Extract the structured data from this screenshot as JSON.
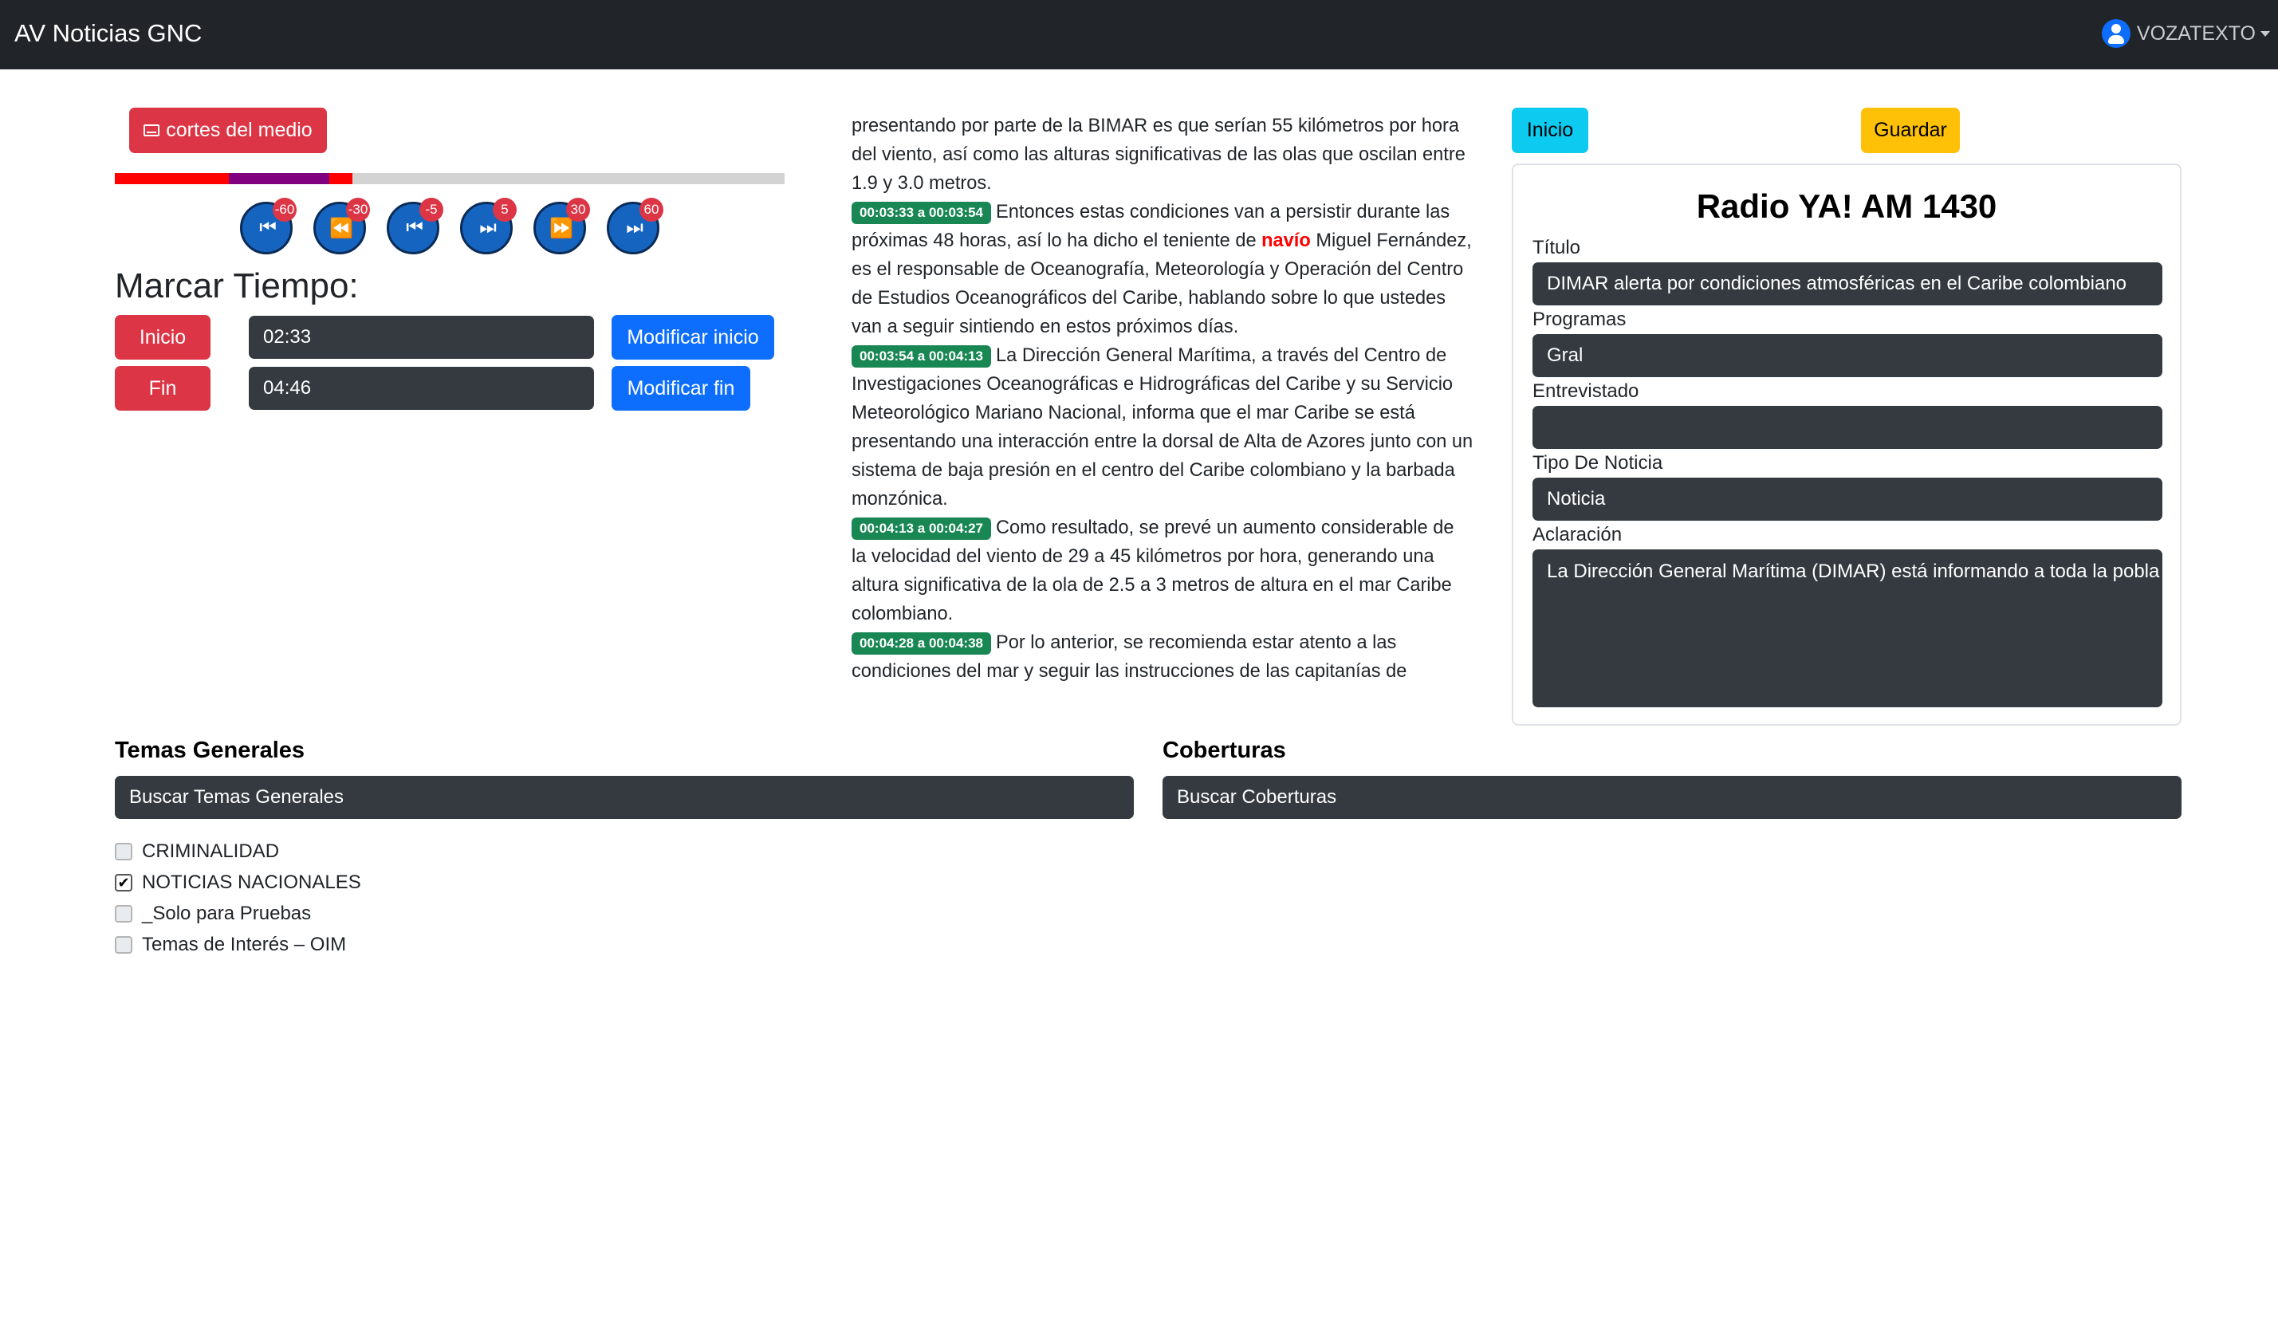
{
  "navbar": {
    "brand": "AV Noticias GNC",
    "user": "VOZATEXTO"
  },
  "player": {
    "cortes_label": "cortes del medio",
    "progress_segments": [
      {
        "from": 0.0,
        "to": 0.17,
        "color": "#ff0000"
      },
      {
        "from": 0.17,
        "to": 0.32,
        "color": "#800080"
      },
      {
        "from": 0.32,
        "to": 0.355,
        "color": "#ff0000"
      }
    ],
    "controls": [
      {
        "glyph": "⏮",
        "badge": "-60"
      },
      {
        "glyph": "⏪",
        "badge": "-30"
      },
      {
        "glyph": "⏮",
        "badge": "-5"
      },
      {
        "glyph": "⏭",
        "badge": "5"
      },
      {
        "glyph": "⏩",
        "badge": "30"
      },
      {
        "glyph": "⏭",
        "badge": "60"
      }
    ]
  },
  "marcar": {
    "title": "Marcar Tiempo:",
    "inicio_label": "Inicio",
    "inicio_value": "02:33",
    "modificar_inicio_label": "Modificar inicio",
    "fin_label": "Fin",
    "fin_value": "04:46",
    "modificar_fin_label": "Modificar fin"
  },
  "transcript": {
    "intro": "presentando por parte de la BIMAR es que serían 55 kilómetros por hora del viento, así como las alturas significativas de las olas que oscilan entre 1.9 y 3.0 metros.",
    "seg1_ts": "00:03:33 a 00:03:54",
    "seg1_a": "Entonces estas condiciones van a persistir durante las próximas 48 horas, así lo ha dicho el teniente de",
    "seg1_hl": "navío",
    "seg1_b": "Miguel Fernández, es el responsable de Oceanografía, Meteorología y Operación del Centro de Estudios Oceanográficos del Caribe, hablando sobre lo que ustedes van a seguir sintiendo en estos próximos días.",
    "seg2_ts": "00:03:54 a 00:04:13",
    "seg2": "La Dirección General Marítima, a través del Centro de Investigaciones Oceanográficas e Hidrográficas del Caribe y su Servicio Meteorológico Mariano Nacional, informa que el mar Caribe se está presentando una interacción entre la dorsal de Alta de Azores junto con un sistema de baja presión en el centro del Caribe colombiano y la barbada monzónica.",
    "seg3_ts": "00:04:13 a 00:04:27",
    "seg3": "Como resultado, se prevé un aumento considerable de la velocidad del viento de 29 a 45 kilómetros por hora, generando una altura significativa de la ola de 2.5 a 3 metros de altura en el mar Caribe colombiano.",
    "seg4_ts": "00:04:28 a 00:04:38",
    "seg4": "Por lo anterior, se recomienda estar atento a las condiciones del mar y seguir las instrucciones de las capitanías de"
  },
  "form": {
    "inicio_button": "Inicio",
    "guardar_button": "Guardar",
    "station": "Radio YA! AM 1430",
    "titulo_label": "Título",
    "titulo_value": "DIMAR alerta por condiciones atmosféricas en el Caribe colombiano",
    "programas_label": "Programas",
    "programas_value": "Gral",
    "entrevistado_label": "Entrevistado",
    "entrevistado_value": "",
    "tipo_label": "Tipo De Noticia",
    "tipo_value": "Noticia",
    "aclaracion_label": "Aclaración",
    "aclaracion_value": "La Dirección General Marítima (DIMAR) está informando a toda la pobla"
  },
  "temas": {
    "title": "Temas Generales",
    "search_placeholder": "Buscar Temas Generales",
    "items": [
      {
        "label": "CRIMINALIDAD",
        "checked": false
      },
      {
        "label": "NOTICIAS NACIONALES",
        "checked": true
      },
      {
        "label": "_Solo para Pruebas",
        "checked": false
      },
      {
        "label": "Temas de Interés – OIM",
        "checked": false
      }
    ]
  },
  "coberturas": {
    "title": "Coberturas",
    "search_placeholder": "Buscar Coberturas"
  }
}
